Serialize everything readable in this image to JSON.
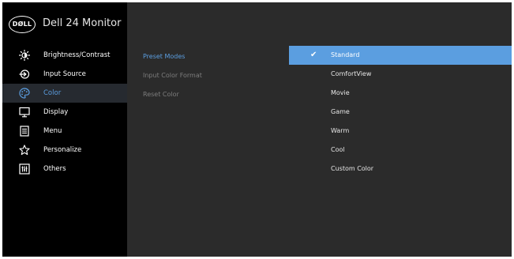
{
  "header": {
    "logo_text": "DØLL",
    "model": "Dell 24 Monitor"
  },
  "sidebar": {
    "items": [
      {
        "label": "Brightness/Contrast",
        "icon": "brightness-icon"
      },
      {
        "label": "Input Source",
        "icon": "input-source-icon"
      },
      {
        "label": "Color",
        "icon": "color-palette-icon",
        "active": true
      },
      {
        "label": "Display",
        "icon": "display-icon"
      },
      {
        "label": "Menu",
        "icon": "menu-icon"
      },
      {
        "label": "Personalize",
        "icon": "star-icon"
      },
      {
        "label": "Others",
        "icon": "others-icon"
      }
    ]
  },
  "submenu": {
    "items": [
      {
        "label": "Preset Modes",
        "active": true
      },
      {
        "label": "Input Color Format"
      },
      {
        "label": "Reset Color"
      }
    ]
  },
  "options": {
    "check_glyph": "✔",
    "selected": "Standard",
    "items": [
      {
        "label": "Standard"
      },
      {
        "label": "ComfortView"
      },
      {
        "label": "Movie"
      },
      {
        "label": "Game"
      },
      {
        "label": "Warm"
      },
      {
        "label": "Cool"
      },
      {
        "label": "Custom Color"
      }
    ]
  },
  "colors": {
    "accent": "#5b9ee0",
    "panel": "#2b2b2b",
    "sidebar": "#000000"
  }
}
